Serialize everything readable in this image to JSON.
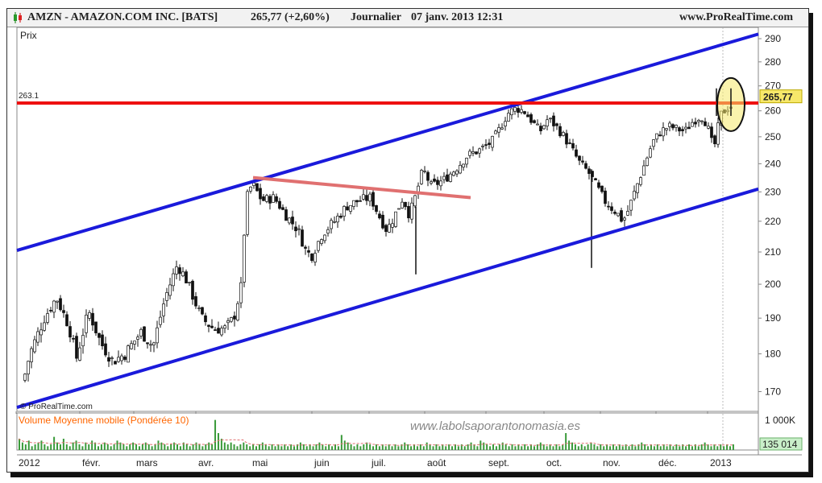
{
  "header": {
    "logo_icon": "green-red-candle-icon",
    "title": "AMZN - AMAZON.COM INC. [BATS]",
    "quote": "265,77 (+2,60%)",
    "period": "Journalier",
    "datetime": "07 janv. 2013 12:31",
    "site": "www.ProRealTime.com"
  },
  "price_panel": {
    "label": "Prix",
    "last_price": "265,77",
    "resistance_label": "263.1",
    "copyright": "© ProRealTime.com"
  },
  "volume_panel": {
    "title": "Volume Moyenne mobile (Pondérée 10)",
    "watermark": "www.labolsaporantonomasia.es",
    "tick_label": "1 000K",
    "last_value": "135 014"
  },
  "colors": {
    "channel": "#1a1adb",
    "resistance": "#ee1111",
    "triangle_line": "#e07070",
    "candle_up": "#0a7a0a",
    "volume_title": "#ff6600",
    "highlight": "#f5e96a",
    "price_badge": "#f7e86a",
    "volume_badge": "#c9efc9"
  },
  "chart_data": {
    "type": "candlestick",
    "y_range": [
      165,
      295
    ],
    "y_ticks": [
      170,
      180,
      190,
      200,
      210,
      220,
      230,
      240,
      250,
      260,
      270,
      280,
      290
    ],
    "x_labels": [
      "2012",
      "févr.",
      "mars",
      "avr.",
      "mai",
      "juin",
      "juil.",
      "août",
      "sept.",
      "oct.",
      "nov.",
      "déc.",
      "2013"
    ],
    "resistance": 263.1,
    "last": 265.77,
    "price_path": [
      [
        0,
        175
      ],
      [
        12,
        171
      ],
      [
        22,
        180
      ],
      [
        40,
        190
      ],
      [
        55,
        196
      ],
      [
        70,
        188
      ],
      [
        80,
        179
      ],
      [
        95,
        192
      ],
      [
        110,
        183
      ],
      [
        125,
        178
      ],
      [
        140,
        180
      ],
      [
        160,
        186
      ],
      [
        175,
        182
      ],
      [
        190,
        196
      ],
      [
        205,
        206
      ],
      [
        215,
        202
      ],
      [
        225,
        196
      ],
      [
        235,
        190
      ],
      [
        250,
        187
      ],
      [
        265,
        187
      ],
      [
        275,
        190
      ],
      [
        285,
        200
      ],
      [
        290,
        227
      ],
      [
        298,
        233
      ],
      [
        310,
        227
      ],
      [
        325,
        228
      ],
      [
        340,
        222
      ],
      [
        355,
        217
      ],
      [
        365,
        210
      ],
      [
        372,
        209
      ],
      [
        385,
        216
      ],
      [
        400,
        220
      ],
      [
        415,
        225
      ],
      [
        430,
        227
      ],
      [
        445,
        228
      ],
      [
        455,
        222
      ],
      [
        465,
        217
      ],
      [
        475,
        222
      ],
      [
        485,
        228
      ],
      [
        493,
        222
      ],
      [
        500,
        228
      ],
      [
        510,
        238
      ],
      [
        520,
        232
      ],
      [
        535,
        234
      ],
      [
        550,
        238
      ],
      [
        565,
        243
      ],
      [
        580,
        245
      ],
      [
        595,
        248
      ],
      [
        605,
        253
      ],
      [
        615,
        259
      ],
      [
        625,
        261
      ],
      [
        635,
        260
      ],
      [
        645,
        256
      ],
      [
        655,
        252
      ],
      [
        665,
        257
      ],
      [
        675,
        254
      ],
      [
        685,
        250
      ],
      [
        695,
        245
      ],
      [
        705,
        240
      ],
      [
        715,
        237
      ],
      [
        725,
        232
      ],
      [
        735,
        227
      ],
      [
        742,
        225
      ],
      [
        750,
        223
      ],
      [
        758,
        220
      ],
      [
        765,
        224
      ],
      [
        775,
        232
      ],
      [
        785,
        240
      ],
      [
        795,
        248
      ],
      [
        805,
        252
      ],
      [
        815,
        254
      ],
      [
        825,
        253
      ],
      [
        835,
        252
      ],
      [
        845,
        256
      ],
      [
        855,
        258
      ],
      [
        862,
        255
      ],
      [
        868,
        248
      ],
      [
        873,
        247
      ],
      [
        878,
        258
      ],
      [
        884,
        260
      ],
      [
        890,
        262
      ]
    ],
    "special_candles": [
      {
        "x": 507,
        "low": 203,
        "high": 225
      },
      {
        "x": 725,
        "low": 205,
        "high": 238
      },
      {
        "x": 880,
        "low": 258,
        "high": 269
      }
    ],
    "volume_values": [
      6,
      4,
      3,
      5,
      2,
      3,
      4,
      5,
      3,
      2,
      3,
      7,
      4,
      3,
      6,
      3,
      2,
      4,
      5,
      3,
      2,
      4,
      3,
      5,
      4,
      2,
      3,
      4,
      3,
      2,
      3,
      5,
      4,
      3,
      2,
      3,
      4,
      3,
      2,
      3,
      4,
      3,
      2,
      3,
      5,
      4,
      3,
      2,
      3,
      4,
      3,
      2,
      4,
      3,
      2,
      3,
      4,
      3,
      2,
      3,
      4,
      3,
      16,
      9,
      6,
      4,
      3,
      4,
      3,
      2,
      3,
      4,
      3,
      2,
      3,
      2,
      3,
      4,
      3,
      2,
      3,
      2,
      3,
      2,
      3,
      2,
      3,
      2,
      3,
      4,
      3,
      2,
      3,
      2,
      3,
      4,
      3,
      2,
      3,
      2,
      3,
      2,
      8,
      5,
      4,
      3,
      2,
      3,
      2,
      3,
      4,
      3,
      2,
      3,
      2,
      3,
      2,
      3,
      2,
      3,
      2,
      3,
      4,
      3,
      2,
      3,
      2,
      3,
      2,
      4,
      3,
      2,
      3,
      2,
      3,
      2,
      3,
      2,
      3,
      2,
      3,
      2,
      3,
      4,
      3,
      2,
      5,
      4,
      3,
      2,
      3,
      2,
      3,
      4,
      3,
      2,
      3,
      2,
      3,
      2,
      3,
      2,
      3,
      2,
      3,
      4,
      3,
      2,
      3,
      2,
      3,
      2,
      3,
      9,
      5,
      4,
      3,
      2,
      3,
      2,
      3,
      4,
      3,
      2,
      3,
      2,
      3,
      2,
      3,
      2,
      3,
      2,
      3,
      2,
      3,
      2,
      3,
      4,
      3,
      2,
      3,
      2,
      3,
      2,
      3,
      2,
      3,
      2,
      3,
      2,
      3,
      2,
      3,
      2,
      3,
      2,
      3,
      4,
      3,
      2,
      3,
      2,
      3,
      2,
      3,
      2,
      3,
      2,
      3,
      2,
      3,
      2,
      3,
      4,
      3,
      2,
      3,
      2,
      3,
      2
    ]
  }
}
